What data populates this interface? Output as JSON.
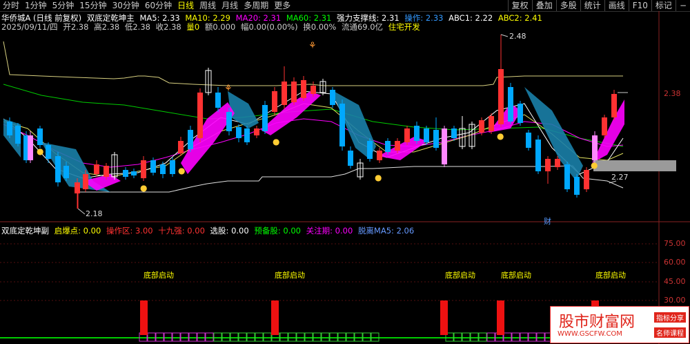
{
  "toolbar": {
    "periods": [
      "分时",
      "1分钟",
      "5分钟",
      "15分钟",
      "30分钟",
      "60分钟",
      "日线",
      "周线",
      "月线",
      "多周期",
      "更多"
    ],
    "active": "日线",
    "right": [
      "复权",
      "叠加",
      "多股",
      "统计",
      "画线",
      "F10",
      "标记"
    ],
    "minus": "−"
  },
  "main_info": {
    "stock": "华侨城A (日线 前复权)",
    "indicator": "双底定乾坤主",
    "ma5": "MA5: 2.33",
    "ma10": "MA10: 2.29",
    "ma20": "MA20: 2.31",
    "ma60": "MA60: 2.31",
    "support": "强力支撑线: 2.31",
    "operate": "操作: 2.33",
    "abc1": "ABC1: 2.22",
    "abc2": "ABC2: 2.41"
  },
  "quote": {
    "date": "2025/09/11/四",
    "open": "开2.38",
    "high": "高2.38",
    "low": "低2.38",
    "close": "收2.38",
    "vol": "量0",
    "amount": "额0.000",
    "amp": "幅0.00(0.00%)",
    "turn": "换0.00%",
    "float": "流通69.0亿",
    "sector": "住宅开发"
  },
  "main_labels": {
    "high_mark": "2.48",
    "low_mark": "2.18",
    "right_price": "2.38",
    "last_low": "2.27",
    "cai": "财"
  },
  "sub_info": {
    "name": "双底定乾坤副",
    "qbd": "启爆点: 0.00",
    "czq": "操作区: 3.00",
    "sjq": "十九强: 0.00",
    "xg": "选股: 0.00",
    "ybg": "预备股: 0.00",
    "gzq": "关注期: 0.00",
    "tl": "脱离MA5: 2.06"
  },
  "sub_axis": [
    "75.00",
    "60.00",
    "45.00",
    "30.00"
  ],
  "signal_label": "底部启动",
  "colors": {
    "up": "#ff3232",
    "down": "#00a8ff",
    "bg": "#000000",
    "pink": "#ff00ff",
    "teal": "#1a7fa8",
    "yellow": "#ffff00"
  },
  "watermark": {
    "title": "股市财富网",
    "url": "WWW.GSCFW.COM",
    "tag1": "指标分享",
    "tag2": "名师课程"
  }
}
